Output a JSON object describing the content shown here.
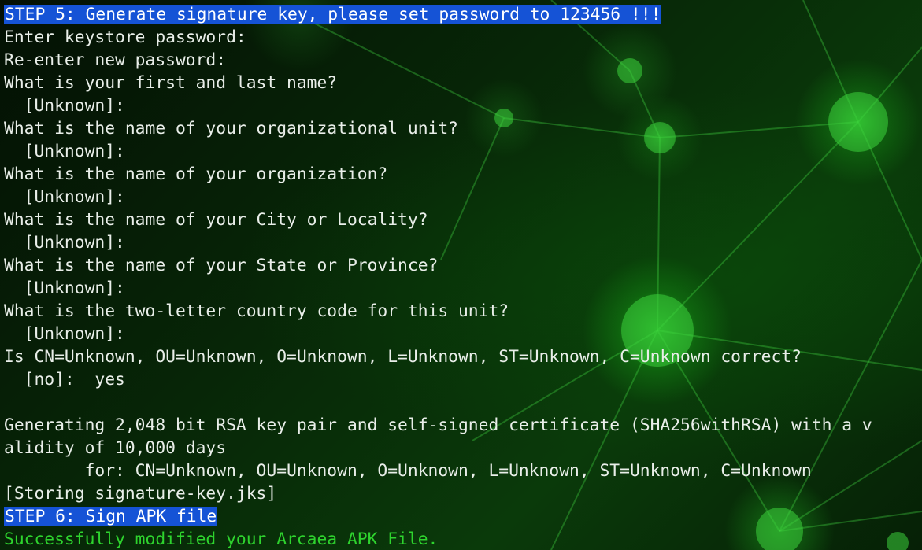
{
  "terminal": {
    "lines": [
      {
        "text": "STEP 5: Generate signature key, please set password to 123456 !!!",
        "style": "highlight"
      },
      {
        "text": "Enter keystore password:",
        "style": "normal"
      },
      {
        "text": "Re-enter new password:",
        "style": "normal"
      },
      {
        "text": "What is your first and last name?",
        "style": "normal"
      },
      {
        "text": "  [Unknown]:",
        "style": "normal"
      },
      {
        "text": "What is the name of your organizational unit?",
        "style": "normal"
      },
      {
        "text": "  [Unknown]:",
        "style": "normal"
      },
      {
        "text": "What is the name of your organization?",
        "style": "normal"
      },
      {
        "text": "  [Unknown]:",
        "style": "normal"
      },
      {
        "text": "What is the name of your City or Locality?",
        "style": "normal"
      },
      {
        "text": "  [Unknown]:",
        "style": "normal"
      },
      {
        "text": "What is the name of your State or Province?",
        "style": "normal"
      },
      {
        "text": "  [Unknown]:",
        "style": "normal"
      },
      {
        "text": "What is the two-letter country code for this unit?",
        "style": "normal"
      },
      {
        "text": "  [Unknown]:",
        "style": "normal"
      },
      {
        "text": "Is CN=Unknown, OU=Unknown, O=Unknown, L=Unknown, ST=Unknown, C=Unknown correct?",
        "style": "normal"
      },
      {
        "text": "  [no]:  yes",
        "style": "normal"
      },
      {
        "text": "",
        "style": "normal"
      },
      {
        "text": "Generating 2,048 bit RSA key pair and self-signed certificate (SHA256withRSA) with a v",
        "style": "normal"
      },
      {
        "text": "alidity of 10,000 days",
        "style": "normal"
      },
      {
        "text": "\tfor: CN=Unknown, OU=Unknown, O=Unknown, L=Unknown, ST=Unknown, C=Unknown",
        "style": "normal"
      },
      {
        "text": "[Storing signature-key.jks]",
        "style": "normal"
      },
      {
        "text": "STEP 6: Sign APK file",
        "style": "highlight"
      },
      {
        "text": "Successfully modified your Arcaea APK File.",
        "style": "success"
      }
    ]
  },
  "colors": {
    "text": "#e9eee9",
    "highlight_bg": "#1553d6",
    "success": "#2ed42e",
    "background": "#072607"
  }
}
